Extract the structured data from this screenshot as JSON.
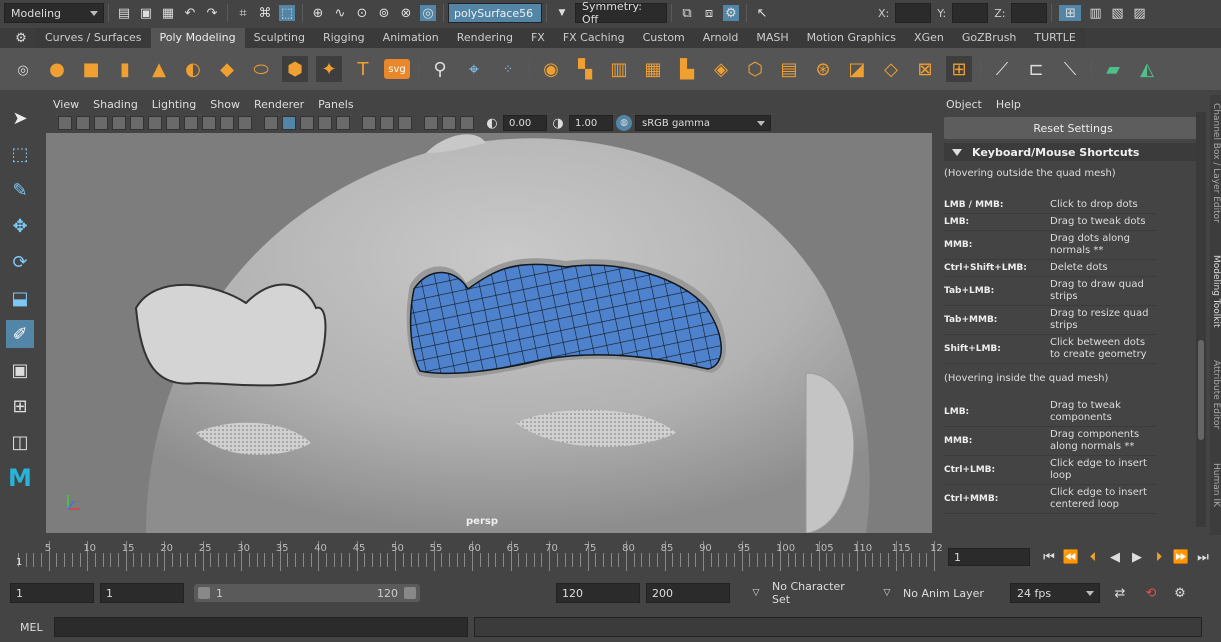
{
  "status": {
    "mode": "Modeling",
    "selection": "polySurface56",
    "symmetry": "Symmetry: Off",
    "x_label": "X:",
    "y_label": "Y:",
    "z_label": "Z:"
  },
  "shelf_tabs": [
    "Curves / Surfaces",
    "Poly Modeling",
    "Sculpting",
    "Rigging",
    "Animation",
    "Rendering",
    "FX",
    "FX Caching",
    "Custom",
    "Arnold",
    "MASH",
    "Motion Graphics",
    "XGen",
    "GoZBrush",
    "TURTLE"
  ],
  "shelf_active": "Poly Modeling",
  "shelf_text_icon": "T",
  "shelf_svg_icon": "svg",
  "viewport": {
    "menus": [
      "View",
      "Shading",
      "Lighting",
      "Show",
      "Renderer",
      "Panels"
    ],
    "exposure": "0.00",
    "gamma": "1.00",
    "color_space": "sRGB gamma",
    "camera": "persp"
  },
  "right_panel": {
    "menus": [
      "Object",
      "Help"
    ],
    "reset_label": "Reset Settings",
    "section_title": "Keyboard/Mouse Shortcuts",
    "outside_note": "(Hovering outside the quad mesh)",
    "inside_note": "(Hovering inside the quad mesh)",
    "outside_shortcuts": [
      {
        "key": "LMB / MMB:",
        "desc": "Click to drop dots"
      },
      {
        "key": "LMB:",
        "desc": "Drag to tweak dots"
      },
      {
        "key": "MMB:",
        "desc": "Drag dots along normals **"
      },
      {
        "key": "Ctrl+Shift+LMB:",
        "desc": "Delete dots"
      },
      {
        "key": "Tab+LMB:",
        "desc": "Drag to draw quad strips"
      },
      {
        "key": "Tab+MMB:",
        "desc": "Drag to resize quad strips"
      },
      {
        "key": "Shift+LMB:",
        "desc": "Click between dots to create geometry"
      }
    ],
    "inside_shortcuts": [
      {
        "key": "LMB:",
        "desc": "Drag to tweak components"
      },
      {
        "key": "MMB:",
        "desc": "Drag components along normals **"
      },
      {
        "key": "Ctrl+LMB:",
        "desc": "Click edge to insert loop"
      },
      {
        "key": "Ctrl+MMB:",
        "desc": "Click edge to insert centered loop"
      }
    ],
    "side_tabs": [
      "Channel Box / Layer Editor",
      "Modeling Toolkit",
      "Attribute Editor",
      "Human IK"
    ]
  },
  "timeline": {
    "ticks": [
      "5",
      "10",
      "15",
      "20",
      "25",
      "30",
      "35",
      "40",
      "45",
      "50",
      "55",
      "60",
      "65",
      "70",
      "75",
      "80",
      "85",
      "90",
      "95",
      "100",
      "105",
      "110",
      "115",
      "12"
    ],
    "start_marker": "1",
    "current_frame": "1"
  },
  "range": {
    "start": "1",
    "playback_start": "1",
    "slider_start": "1",
    "slider_end": "120",
    "playback_end": "120",
    "end": "200",
    "character_set": "No Character Set",
    "anim_layer": "No Anim Layer",
    "fps": "24 fps"
  },
  "command": {
    "language": "MEL"
  }
}
